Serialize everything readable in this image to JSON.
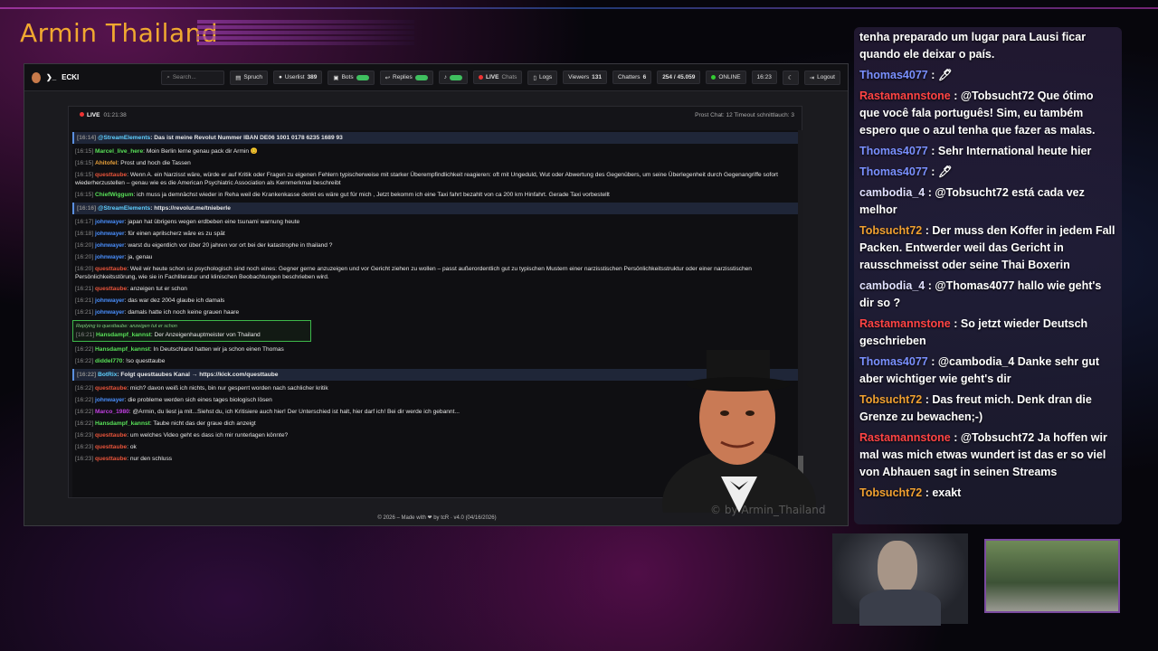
{
  "overlay": {
    "title": "Armin Thailand",
    "watermark": "© by Armin_Thailand"
  },
  "navbar": {
    "brand": "ECKI",
    "search_placeholder": "Search...",
    "spruch": "Spruch",
    "userlist": "Userlist",
    "userlist_count": "389",
    "bots": "Bots",
    "replies": "Replies",
    "live": "LIVE",
    "chats": "Chats",
    "logs": "Logs",
    "viewers_label": "Viewers",
    "viewers_count": "131",
    "chatters_label": "Chatters",
    "chatters_count": "6",
    "ratio": "254 / 45.059",
    "online": "ONLINE",
    "time": "16:23",
    "logout": "Logout"
  },
  "chat_header": {
    "live": "LIVE",
    "uptime": "01:21:38",
    "stats": "Prost Chat: 12   Timeout schnittlauch: 3"
  },
  "messages": [
    {
      "ts": "[16:14]",
      "user": "@StreamElements",
      "color": "#5fd0ff",
      "text": "Das ist meine Revolut Nummer IBAN DE06 1001 0178 6235 1689 93",
      "hl": true
    },
    {
      "ts": "[16:15]",
      "user": "Marcel_live_here",
      "color": "#58e058",
      "text": "Moin Berlin lerne genau pack dir Armin 😊"
    },
    {
      "ts": "[16:15]",
      "user": "Ahitofel",
      "color": "#e8a03a",
      "text": "Prost und hoch die Tassen"
    },
    {
      "ts": "[16:15]",
      "user": "questtaube",
      "color": "#e8543a",
      "text": "Wenn A. ein Narzisst wäre, würde er auf Kritik oder Fragen zu eigenen Fehlern typischerweise mit starker Überempfindlichkeit reagieren: oft mit Ungeduld, Wut oder Abwertung des Gegenübers, um seine Überlegenheit durch Gegenangriffe sofort wiederherzustellen – genau wie es die American Psychiatric Association als Kernmerkmal beschreibt"
    },
    {
      "ts": "[16:15]",
      "user": "ChiefWiggum",
      "color": "#58e058",
      "text": "ich muss ja demnächst wieder in Reha weil die Krankenkasse denkt es wäre gut für mich , Jetzt bekomm ich eine Taxi fahrt bezahlt von ca 200 km Hinfahrt. Gerade Taxi vorbestellt"
    },
    {
      "ts": "[16:16]",
      "user": "@StreamElements",
      "color": "#5fd0ff",
      "text": "https://revolut.me/tnieberle",
      "hl": true
    },
    {
      "ts": "[16:17]",
      "user": "johnwayer",
      "color": "#4a90ff",
      "text": "japan hat übrigens wegen erdbeben eine tsunami warnung heute"
    },
    {
      "ts": "[16:18]",
      "user": "johnwayer",
      "color": "#4a90ff",
      "text": "für einen aprilscherz wäre es zu spät"
    },
    {
      "ts": "[16:20]",
      "user": "johnwayer",
      "color": "#4a90ff",
      "text": "warst du eigentlich vor über 20 jahren vor ort bei der katastrophe in thailand ?"
    },
    {
      "ts": "[16:20]",
      "user": "johnwayer",
      "color": "#4a90ff",
      "text": "ja, genau"
    },
    {
      "ts": "[16:20]",
      "user": "questtaube",
      "color": "#e8543a",
      "text": "Weil wir heute schon so psychologisch sind noch eines: Gegner gerne anzuzeigen und vor Gericht ziehen zu wollen – passt außerordentlich gut zu typischen Mustern einer narzisstischen Persönlichkeitsstruktur oder einer narzisstischen Persönlichkeitsstörung, wie sie in Fachliteratur und klinischen Beobachtungen beschrieben wird."
    },
    {
      "ts": "[16:21]",
      "user": "questtaube",
      "color": "#e8543a",
      "text": "anzeigen tut er schon"
    },
    {
      "ts": "[16:21]",
      "user": "johnwayer",
      "color": "#4a90ff",
      "text": "das war dez 2004 glaube ich damals"
    },
    {
      "ts": "[16:21]",
      "user": "johnwayer",
      "color": "#4a90ff",
      "text": "damals hatte ich noch keine grauen haare"
    },
    {
      "ts": "[16:21]",
      "user": "Hansdampf_kannst",
      "color": "#58e058",
      "text": "Der Anzeigenhauptmeister von Thailand",
      "reply": "Replying to questtaube: anzeigen tut er schon"
    },
    {
      "ts": "[16:22]",
      "user": "Hansdampf_kannst",
      "color": "#58e058",
      "text": "In Deutschland hatten wir ja schon einen Thomas"
    },
    {
      "ts": "[16:22]",
      "user": "diddel770",
      "color": "#58e058",
      "text": "!so questtaube"
    },
    {
      "ts": "[16:22]",
      "user": "BotRix",
      "color": "#5fd0ff",
      "text": "Folgt questtaubes Kanal → https://kick.com/questtaube",
      "hl": true
    },
    {
      "ts": "[16:22]",
      "user": "questtaube",
      "color": "#e8543a",
      "text": "mich? davon weiß ich nichts, bin nur gesperrt worden nach sachlicher kritik"
    },
    {
      "ts": "[16:22]",
      "user": "johnwayer",
      "color": "#4a90ff",
      "text": "die probleme werden sich eines tages biologisch lösen"
    },
    {
      "ts": "[16:22]",
      "user": "Marco_1980",
      "color": "#c040e0",
      "text": "@Armin, du liest ja mit...Siehst du, ich Kritisiere auch hier! Der Unterschied ist halt, hier darf ich! Bei dir werde ich gebannt..."
    },
    {
      "ts": "[16:22]",
      "user": "Hansdampf_kannst",
      "color": "#58e058",
      "text": "Taube nicht das der graue dich anzeigt"
    },
    {
      "ts": "[16:23]",
      "user": "questtaube",
      "color": "#e8543a",
      "text": "um welches Video geht es dass ich mir runterlagen könnte?"
    },
    {
      "ts": "[16:23]",
      "user": "questtaube",
      "color": "#e8543a",
      "text": "ok"
    },
    {
      "ts": "[16:23]",
      "user": "questtaube",
      "color": "#e8543a",
      "text": "nur den schluss"
    }
  ],
  "footer": "© 2026 – Made with ❤ by tcR · v4.0 (04/16/2026)",
  "stream_chat": [
    {
      "user": "",
      "color": "#fff",
      "text": "tenha preparado um lugar para Lausi ficar quando ele deixar o país."
    },
    {
      "user": "Thomas4077",
      "color": "#7a90ff",
      "text": ": 🖊"
    },
    {
      "user": "Rastamannstone",
      "color": "#ff4444",
      "text": ": @Tobsucht72 Que ótimo que você fala português! Sim, eu também espero que o azul tenha que fazer as malas."
    },
    {
      "user": "Thomas4077",
      "color": "#7a90ff",
      "text": ": Sehr International heute hier"
    },
    {
      "user": "Thomas4077",
      "color": "#7a90ff",
      "text": ": 🖊"
    },
    {
      "user": "cambodia_4",
      "color": "#e0e0ff",
      "text": ": @Tobsucht72 está cada vez melhor"
    },
    {
      "user": "Tobsucht72",
      "color": "#f0a030",
      "text": ": Der muss den Koffer in jedem Fall Packen. Entwerder weil das Gericht in rausschmeisst oder seine Thai Boxerin"
    },
    {
      "user": "cambodia_4",
      "color": "#e0e0ff",
      "text": ": @Thomas4077 hallo wie geht's dir so ?"
    },
    {
      "user": "Rastamannstone",
      "color": "#ff4444",
      "text": ": So jetzt wieder Deutsch geschrieben"
    },
    {
      "user": "Thomas4077",
      "color": "#7a90ff",
      "text": ": @cambodia_4 Danke sehr gut aber wichtiger wie geht's dir"
    },
    {
      "user": "Tobsucht72",
      "color": "#f0a030",
      "text": ": Das freut mich. Denk dran die Grenze zu bewachen;-)"
    },
    {
      "user": "Rastamannstone",
      "color": "#ff4444",
      "text": ": @Tobsucht72 Ja hoffen wir mal was mich etwas wundert ist das er so viel von Abhauen sagt in seinen Streams"
    },
    {
      "user": "Tobsucht72",
      "color": "#f0a030",
      "text": ": exakt"
    }
  ]
}
